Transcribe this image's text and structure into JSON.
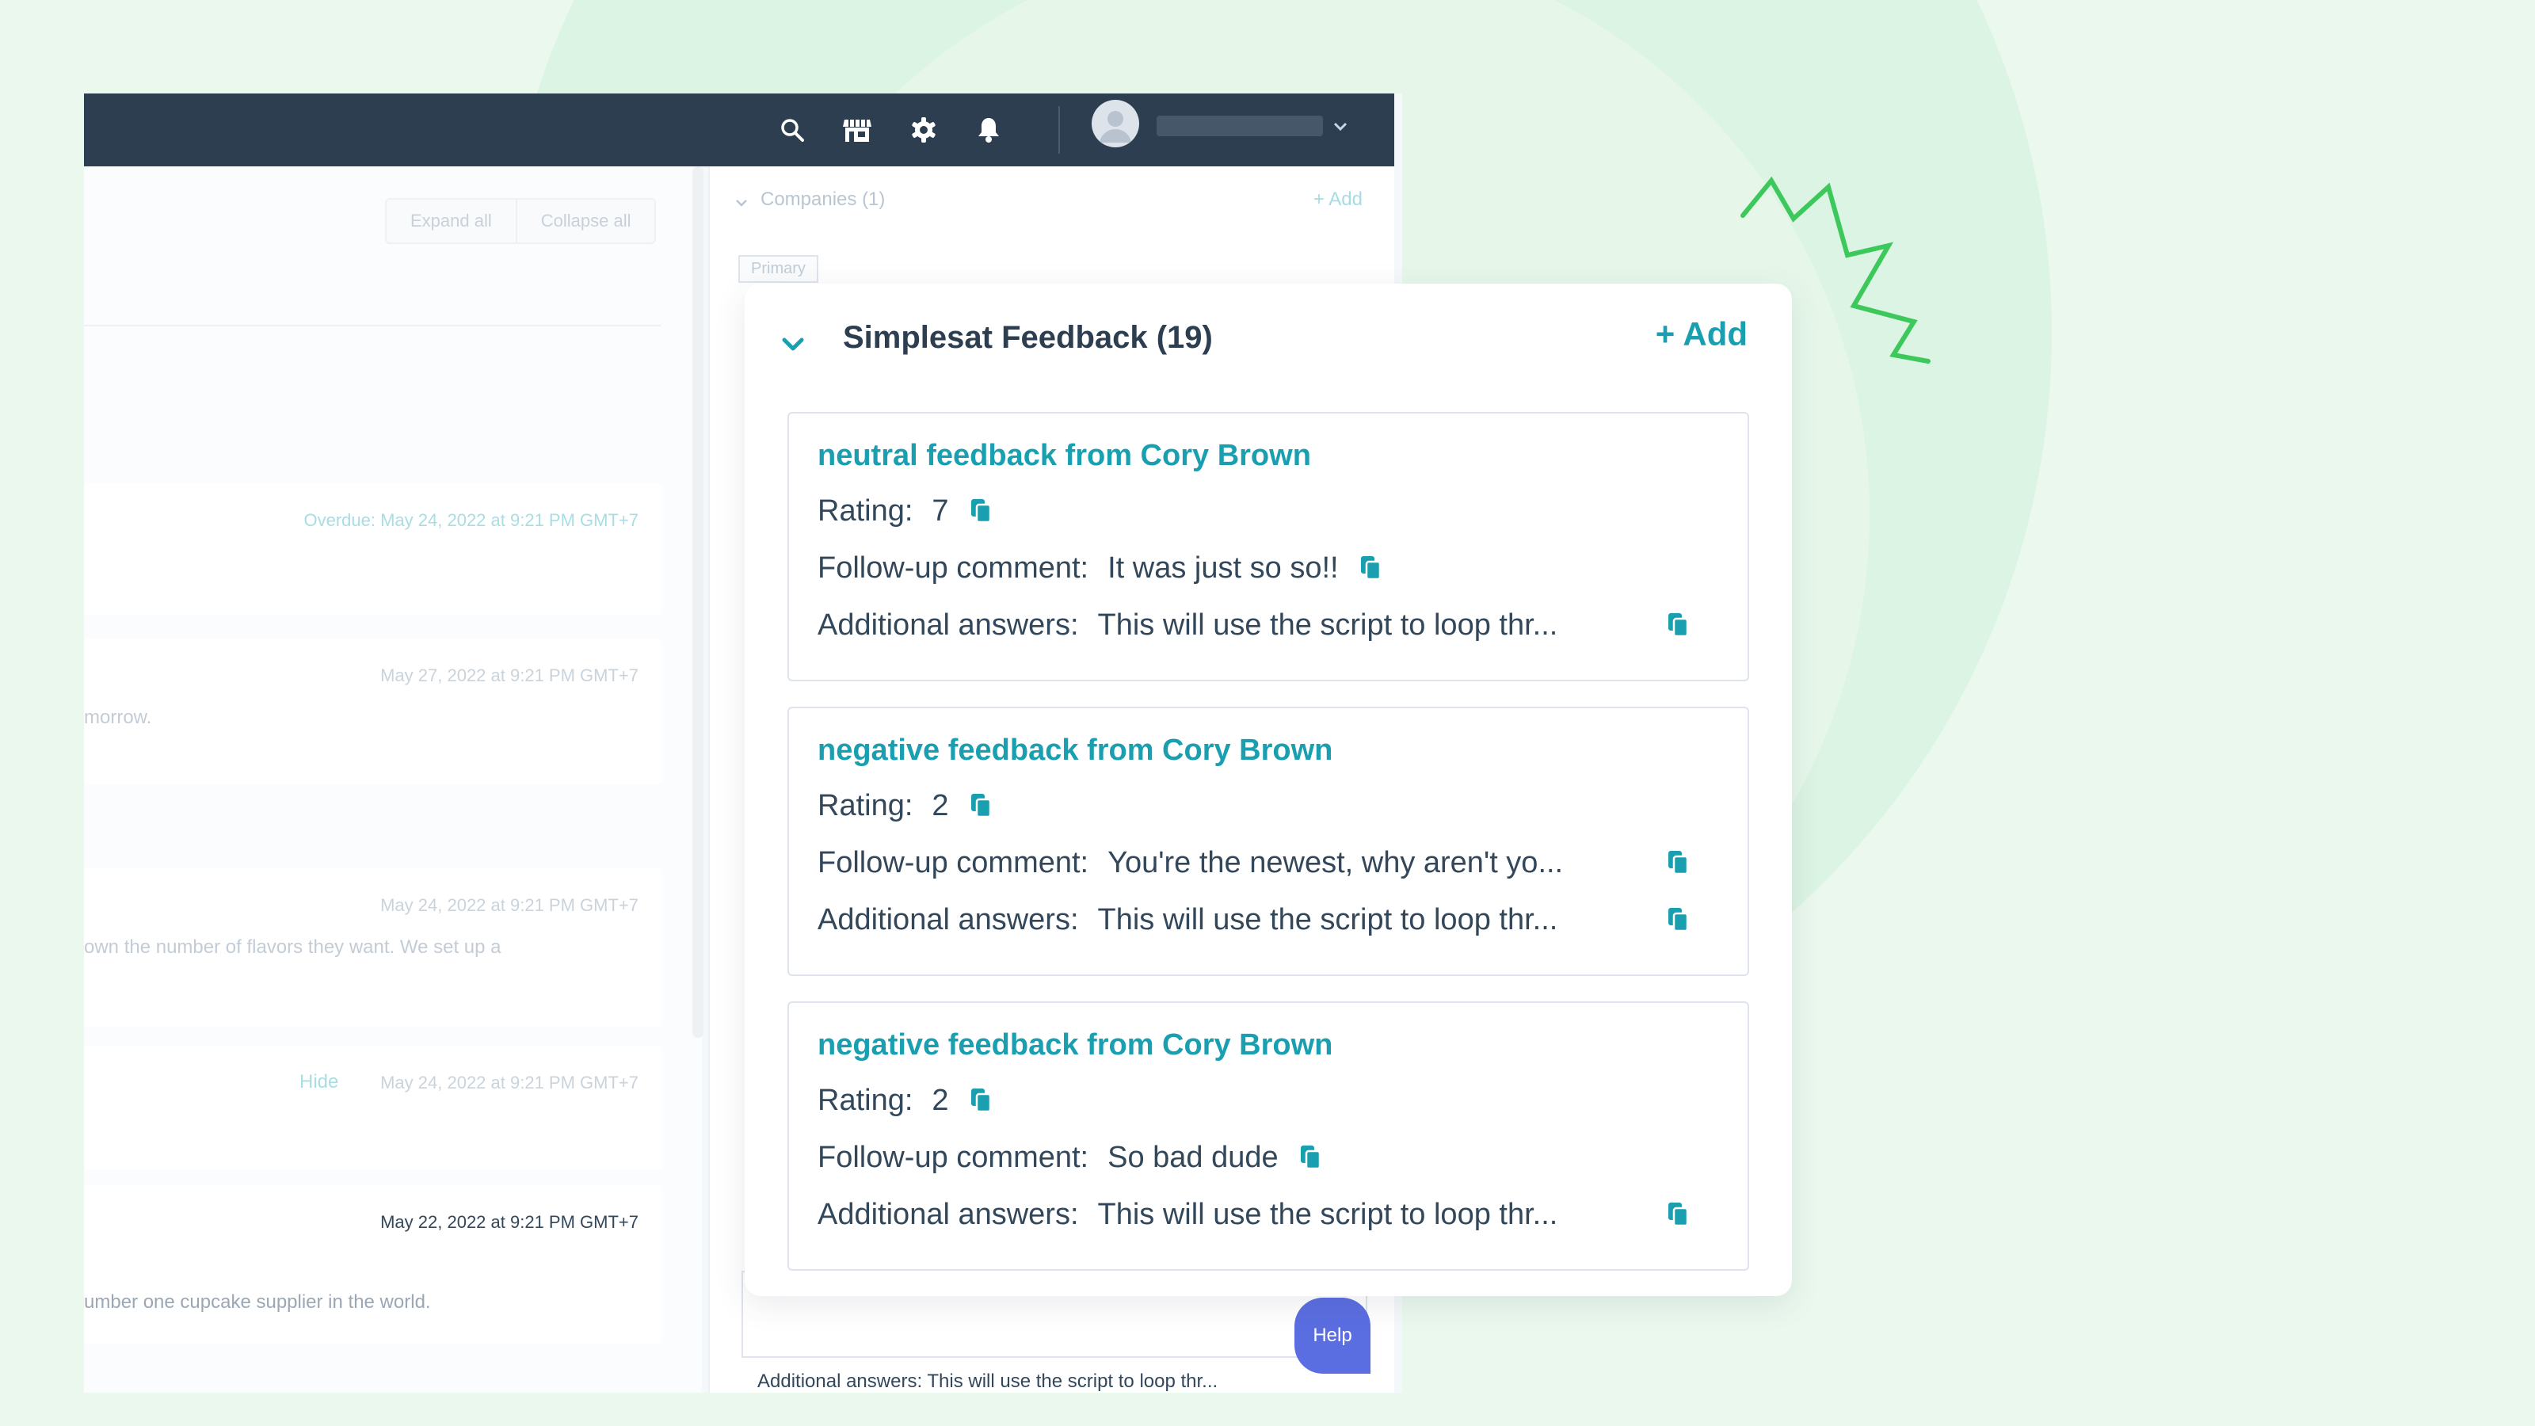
{
  "toolbar": {
    "icons": [
      "search-icon",
      "marketplace-icon",
      "gear-icon",
      "bell-icon"
    ],
    "user_icon": "avatar-icon"
  },
  "left_pane": {
    "expand_label": "Expand all",
    "collapse_label": "Collapse all",
    "cards": [
      {
        "date": "Overdue: May 24, 2022 at 9:21 PM GMT+7",
        "snippet": ""
      },
      {
        "date": "May 27, 2022 at 9:21 PM GMT+7",
        "snippet": "morrow."
      },
      {
        "date": "May 24, 2022 at 9:21 PM GMT+7",
        "snippet": "own the number of flavors they want. We set up a"
      },
      {
        "date": "May 24, 2022 at 9:21 PM GMT+7",
        "snippet": "",
        "link": "Hide"
      },
      {
        "date": "May 22, 2022 at 9:21 PM GMT+7",
        "snippet": "umber one cupcake supplier in the world."
      }
    ]
  },
  "right_pane": {
    "companies_label": "Companies (1)",
    "add_label": "+ Add",
    "primary_tag": "Primary",
    "bottom_text": "Additional answers:  This will use the script to loop thr..."
  },
  "help": {
    "label": "Help"
  },
  "panel": {
    "title": "Simplesat Feedback (19)",
    "add_label": "+ Add",
    "labels": {
      "rating": "Rating:",
      "follow_up": "Follow-up comment:",
      "additional": "Additional answers:"
    },
    "cards": [
      {
        "title": "neutral feedback from Cory Brown",
        "rating": "7",
        "follow_up": "It was just so so!!",
        "additional": "This will use the script to loop thr..."
      },
      {
        "title": "negative feedback from Cory Brown",
        "rating": "2",
        "follow_up": "You're the newest, why aren't yo...",
        "additional": "This will use the script to loop thr..."
      },
      {
        "title": "negative feedback from Cory Brown",
        "rating": "2",
        "follow_up": "So bad dude",
        "additional": "This will use the script to loop thr..."
      }
    ]
  },
  "colors": {
    "accent": "#1a9fb0",
    "topbar": "#2d3e50",
    "background": "#eaf8ee",
    "squiggle": "#3cc85a",
    "help": "#5b6ee1"
  }
}
